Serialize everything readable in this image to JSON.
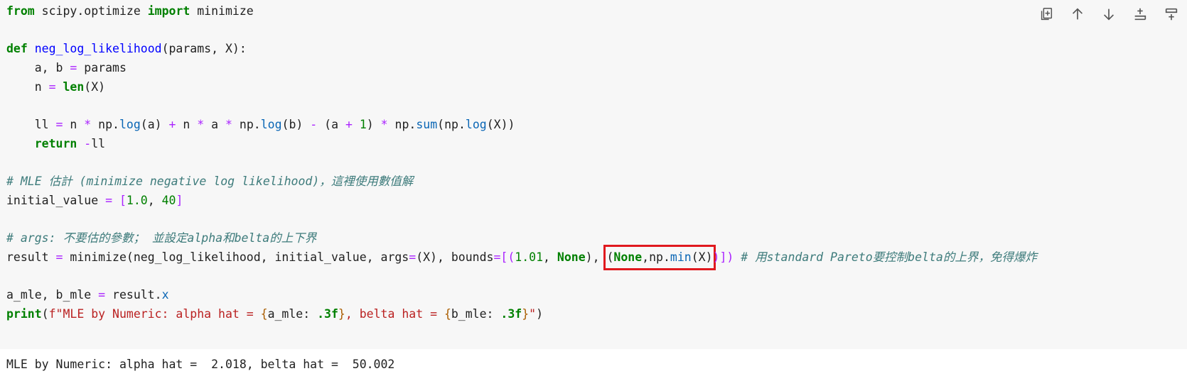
{
  "toolbar": {
    "items": [
      {
        "icon": "copy-cell-icon"
      },
      {
        "icon": "move-up-icon"
      },
      {
        "icon": "move-down-icon"
      },
      {
        "icon": "insert-above-icon"
      },
      {
        "icon": "insert-below-icon"
      }
    ]
  },
  "code": {
    "l1": {
      "kw1": "from",
      "t1": " scipy.optimize ",
      "kw2": "import",
      "t2": " minimize"
    },
    "l3": {
      "kw": "def",
      "fn": "neg_log_likelihood",
      "t": "(params, X):"
    },
    "l4": {
      "t1": "    a, b ",
      "op": "=",
      "t2": " params"
    },
    "l5": {
      "t1": "    n ",
      "op": "=",
      "sp": " ",
      "fn": "len",
      "t2": "(X)"
    },
    "l7": {
      "t1": "    ll ",
      "op1": "=",
      "t2": " n ",
      "op2": "*",
      "t3": " np.",
      "a1": "log",
      "t4": "(a) ",
      "op3": "+",
      "t5": " n ",
      "op4": "*",
      "t6": " a ",
      "op5": "*",
      "t7": " np.",
      "a2": "log",
      "t8": "(b) ",
      "op6": "-",
      "t9": " (a ",
      "op7": "+",
      "sp": " ",
      "n1": "1",
      "t10": ") ",
      "op8": "*",
      "t11": " np.",
      "a3": "sum",
      "t12": "(np.",
      "a4": "log",
      "t13": "(X))"
    },
    "l8": {
      "ind": "    ",
      "kw": "return",
      "sp": " ",
      "op": "-",
      "t": "ll"
    },
    "l10": {
      "comment": "# MLE 估計 (minimize negative log likelihood)，這裡使用數值解"
    },
    "l11": {
      "t1": "initial_value ",
      "op": "=",
      "sp": " ",
      "t2": "[",
      "n1": "1.0",
      "t3": ", ",
      "n2": "40",
      "t4": "]"
    },
    "l13": {
      "comment": "# args: 不要估的參數； 並設定alpha和belta的上下界"
    },
    "l14": {
      "t1": "result ",
      "op1": "=",
      "t2": " minimize(neg_log_likelihood, initial_value, args",
      "op2": "=",
      "t3": "(X), bounds",
      "op3": "=",
      "t4": "[(",
      "n1": "1.01",
      "t5": ", ",
      "b1": "None",
      "t6": "), ",
      "h1": "(",
      "b2": "None",
      "h2": ",np.",
      "a1": "min",
      "h3": "(X)",
      "t7": ")]) ",
      "comment": "# 用standard Pareto要控制belta的上界，免得爆炸"
    },
    "l16": {
      "t1": "a_mle, b_mle ",
      "op": "=",
      "t2": " result.",
      "a": "x"
    },
    "l17": {
      "fn": "print",
      "t1": "(",
      "s1": "f\"MLE by Numeric: alpha hat = ",
      "br1": "{",
      "t2": "a_mle: ",
      "f1": ".3f",
      "br2": "}",
      "s2": ", belta hat = ",
      "br3": "{",
      "t3": "b_mle: ",
      "f2": ".3f",
      "br4": "}",
      "s3": "\"",
      "t4": ")"
    }
  },
  "output": {
    "text": "MLE by Numeric: alpha hat =  2.018, belta hat =  50.002"
  }
}
